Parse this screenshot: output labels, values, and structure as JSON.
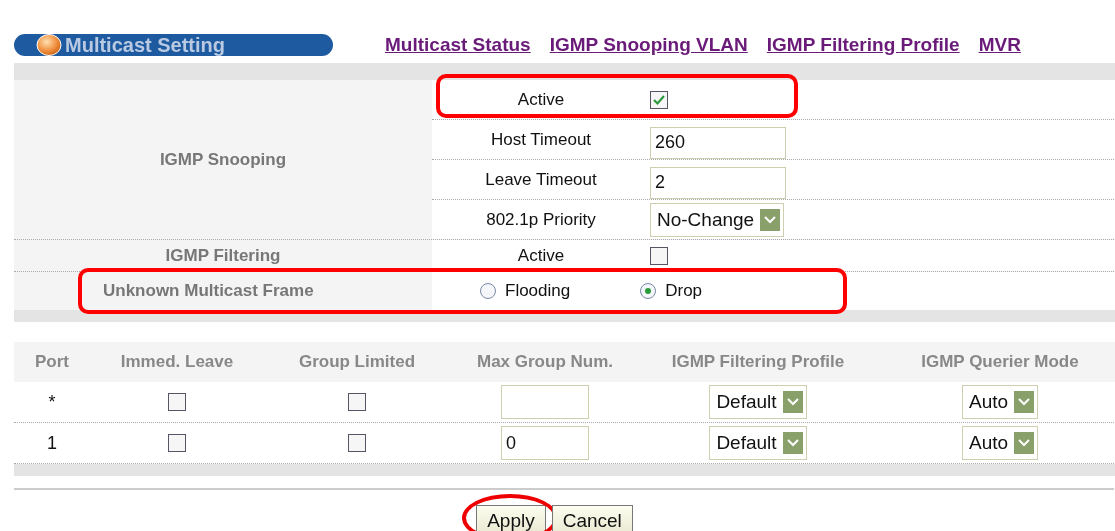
{
  "header": {
    "title": "Multicast Setting",
    "links": [
      "Multicast Status",
      "IGMP Snooping VLAN",
      "IGMP Filtering Profile",
      "MVR"
    ]
  },
  "igmp_snooping": {
    "label": "IGMP Snooping",
    "fields": [
      {
        "kind": "checkbox",
        "label": "Active",
        "checked": true,
        "highlighted": true
      },
      {
        "kind": "text",
        "label": "Host Timeout",
        "value": "260",
        "highlighted": false
      },
      {
        "kind": "text",
        "label": "Leave Timeout",
        "value": "2",
        "highlighted": false
      },
      {
        "kind": "select",
        "label": "802.1p Priority",
        "value": "No-Change",
        "highlighted": false
      }
    ]
  },
  "igmp_filtering": {
    "label": "IGMP Filtering",
    "field": {
      "label": "Active",
      "checked": false
    }
  },
  "unknown_multicast_frame": {
    "label": "Unknown Multicast Frame",
    "highlighted": true,
    "options": [
      {
        "label": "Flooding",
        "selected": false
      },
      {
        "label": "Drop",
        "selected": true
      }
    ]
  },
  "port_table": {
    "columns": [
      "Port",
      "Immed. Leave",
      "Group Limited",
      "Max Group Num.",
      "IGMP Filtering Profile",
      "IGMP Querier Mode"
    ],
    "rows": [
      {
        "port": "*",
        "immed_leave": false,
        "group_limited": false,
        "filtering_profile": "Default",
        "querier_mode": "Auto"
      },
      {
        "port": "1",
        "immed_leave": false,
        "group_limited": false,
        "max_group_num": "0",
        "filtering_profile": "Default",
        "querier_mode": "Auto"
      }
    ]
  },
  "buttons": [
    {
      "label": "Apply",
      "highlighted": true
    },
    {
      "label": "Cancel",
      "highlighted": false
    }
  ]
}
